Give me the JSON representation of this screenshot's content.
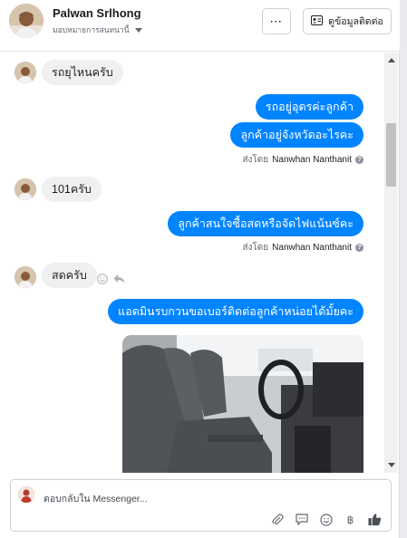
{
  "header": {
    "contact_name": "Palwan Srlhong",
    "assign_label": "มอบหมายการสนทนานี้",
    "more_label": "···",
    "info_button_label": "ดูข้อมูลติดต่อ"
  },
  "messages": [
    {
      "direction": "in",
      "text": "รถยุไหนครับ"
    },
    {
      "direction": "out",
      "text": "รถอยู่อุดรค่ะลูกค้า"
    },
    {
      "direction": "out",
      "text": "ลูกค้าอยู่จังหวัดอะไรคะ"
    },
    {
      "direction": "in",
      "text": "101ครับ"
    },
    {
      "direction": "out",
      "text": "ลูกค้าสนใจซื้อสดหรือจัดไฟแน้นซ์คะ"
    },
    {
      "direction": "in",
      "text": "สดครับ"
    },
    {
      "direction": "out",
      "text": "แอดมินรบกวนขอเบอร์ติดต่อลูกค้าหน่อยได้มั้ยคะ"
    }
  ],
  "sent_by": {
    "prefix": "ส่งโดย",
    "agent": "Nanwhan Nanthanit",
    "help_icon": "?"
  },
  "composer": {
    "placeholder": "ตอบกลับใน Messenger...",
    "currency_icon": "฿"
  },
  "colors": {
    "outgoing_bubble": "#0084ff",
    "incoming_bubble": "#f0f0f0"
  }
}
